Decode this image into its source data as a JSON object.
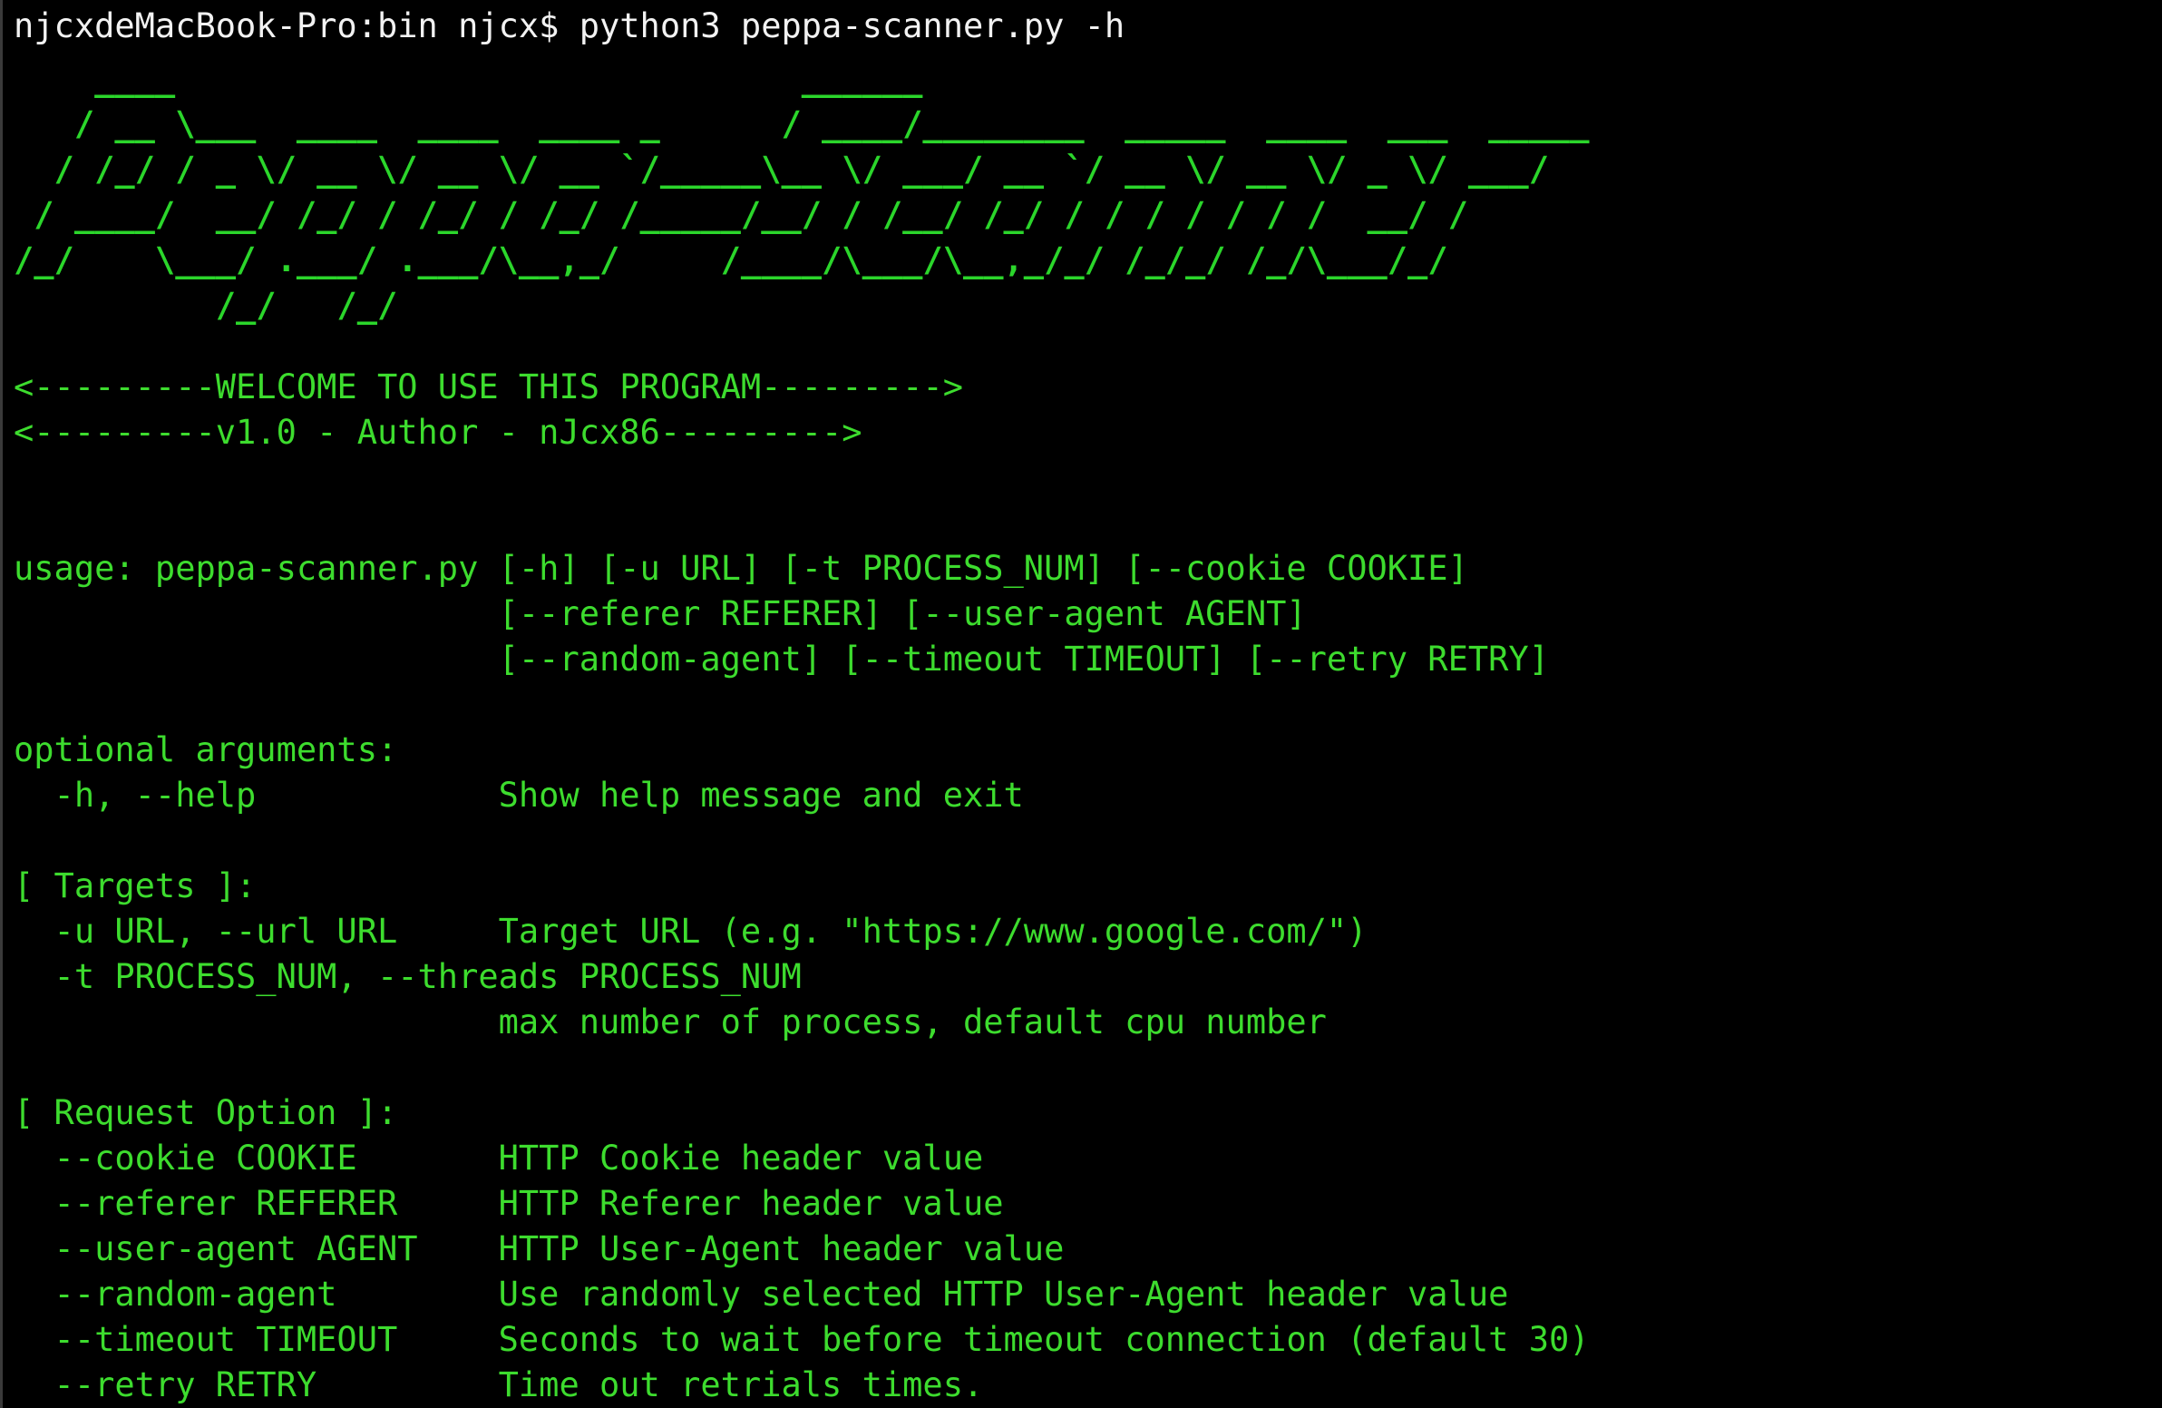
{
  "terminal": {
    "prompt_text": "njcxdeMacBook-Pro:bin njcx$ python3 peppa-scanner.py -h"
  },
  "banner": {
    "ascii_art": "    ____                               ______\n   / __ \\___  ____  ____  ____ _      / ____/________  _____  ____  ___  _____\n  / /_/ / _ \\/ __ \\/ __ \\/ __ `/_____\\__ \\/ ___/ __ `/ __ \\/ __ \\/ _ \\/ ___/\n / ____/  __/ /_/ / /_/ / /_/ /_____/__/ / /__/ /_/ / / / / / / /  __/ /\n/_/    \\___/ .___/ .___/\\__,_/     /____/\\___/\\__,_/_/ /_/_/ /_/\\___/_/\n          /_/   /_/",
    "welcome": "<---------WELCOME TO USE THIS PROGRAM--------->",
    "version": "<---------v1.0 - Author - nJcx86--------->"
  },
  "usage": {
    "line1": "usage: peppa-scanner.py [-h] [-u URL] [-t PROCESS_NUM] [--cookie COOKIE]",
    "line2": "                        [--referer REFERER] [--user-agent AGENT]",
    "line3": "                        [--random-agent] [--timeout TIMEOUT] [--retry RETRY]"
  },
  "optional": {
    "heading": "optional arguments:",
    "help": "  -h, --help            Show help message and exit"
  },
  "targets": {
    "heading": "[ Targets ]:",
    "url": "  -u URL, --url URL     Target URL (e.g. \"https://www.google.com/\")",
    "threads": "  -t PROCESS_NUM, --threads PROCESS_NUM",
    "threads_desc": "                        max number of process, default cpu number"
  },
  "request": {
    "heading": "[ Request Option ]:",
    "cookie": "  --cookie COOKIE       HTTP Cookie header value",
    "referer": "  --referer REFERER     HTTP Referer header value",
    "user_agent": "  --user-agent AGENT    HTTP User-Agent header value",
    "random_agent": "  --random-agent        Use randomly selected HTTP User-Agent header value",
    "timeout": "  --timeout TIMEOUT     Seconds to wait before timeout connection (default 30)",
    "retry": "  --retry RETRY         Time out retrials times."
  },
  "colors": {
    "background": "#000000",
    "output_green": "#3ddc2e",
    "prompt_white": "#f2f2f2"
  }
}
